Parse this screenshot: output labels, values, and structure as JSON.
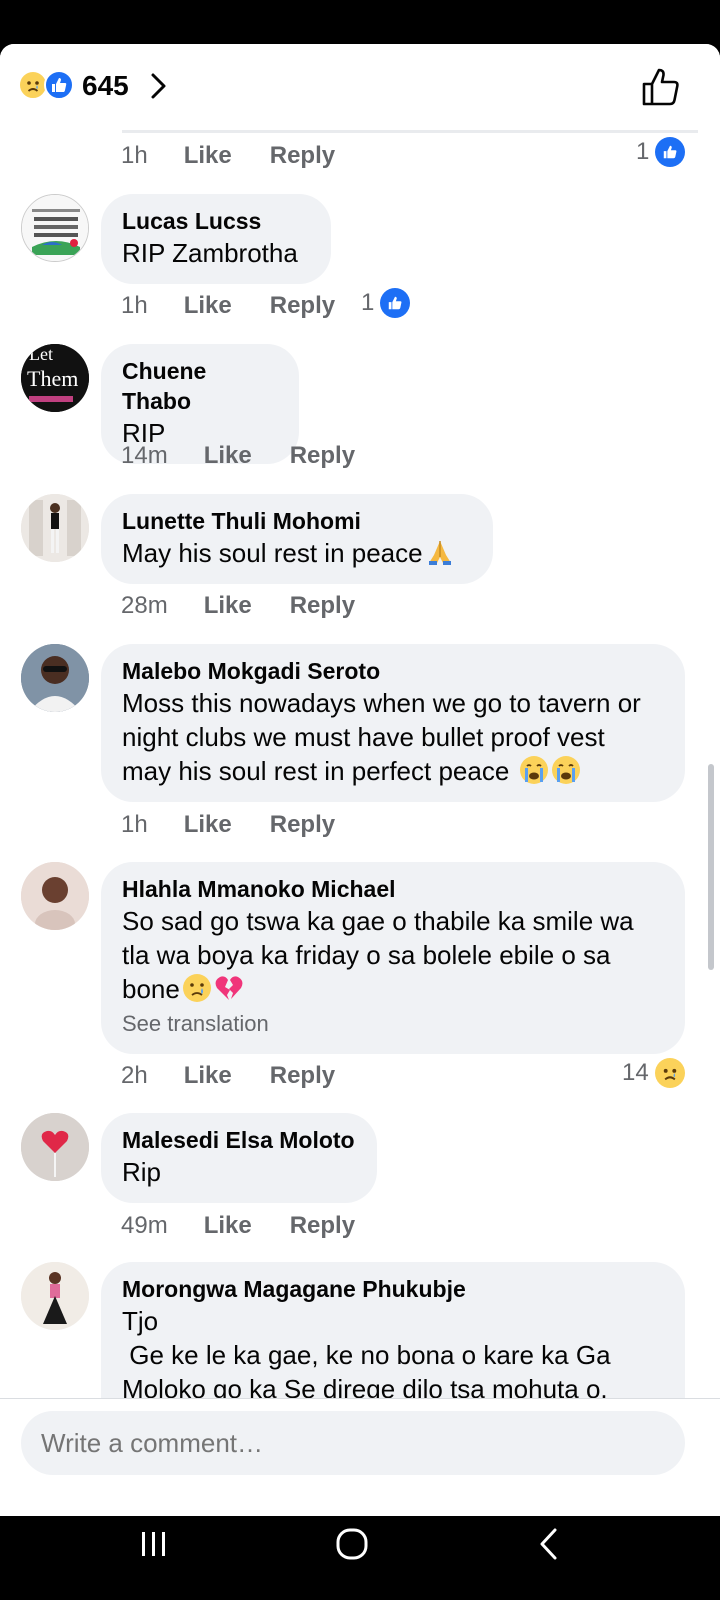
{
  "header": {
    "reaction_count": "645"
  },
  "first_row": {
    "time": "1h",
    "like": "Like",
    "reply": "Reply",
    "reaction_count": "1"
  },
  "comments": [
    {
      "author": "Lucas Lucss",
      "text": "RIP Zambrotha",
      "time": "1h",
      "like": "Like",
      "reply": "Reply",
      "reaction_count": "1"
    },
    {
      "author": "Chuene Thabo",
      "text": "RIP",
      "time": "14m",
      "like": "Like",
      "reply": "Reply"
    },
    {
      "author": "Lunette Thuli Mohomi",
      "text": "May his soul rest in peace",
      "time": "28m",
      "like": "Like",
      "reply": "Reply"
    },
    {
      "author": "Malebo Mokgadi Seroto",
      "text": "Moss this nowadays when we go to tavern or\nnight clubs we must have bullet proof vest\nmay his soul rest in perfect peace ",
      "time": "1h",
      "like": "Like",
      "reply": "Reply"
    },
    {
      "author": "Hlahla Mmanoko Michael",
      "text": "So sad go tswa ka gae o thabile ka smile wa\ntla wa boya ka friday o sa bolele ebile o sa\nbone",
      "see_translation": "See translation",
      "time": "2h",
      "like": "Like",
      "reply": "Reply",
      "reaction_count": "14"
    },
    {
      "author": "Malesedi Elsa Moloto",
      "text": "Rip",
      "time": "49m",
      "like": "Like",
      "reply": "Reply"
    },
    {
      "author": "Morongwa Magagane Phukubje",
      "text": "Tjo\n Ge ke le ka gae, ke no bona o kare ka Ga\nMoloko go ka Se direge dilo tsa mohuta o."
    }
  ],
  "avatar_text": {
    "chuene": "Let\nThem"
  },
  "composer": {
    "placeholder": "Write a comment…"
  },
  "colors": {
    "accent": "#1d6ff5",
    "bubble": "#f0f2f5",
    "meta": "#65676b"
  }
}
